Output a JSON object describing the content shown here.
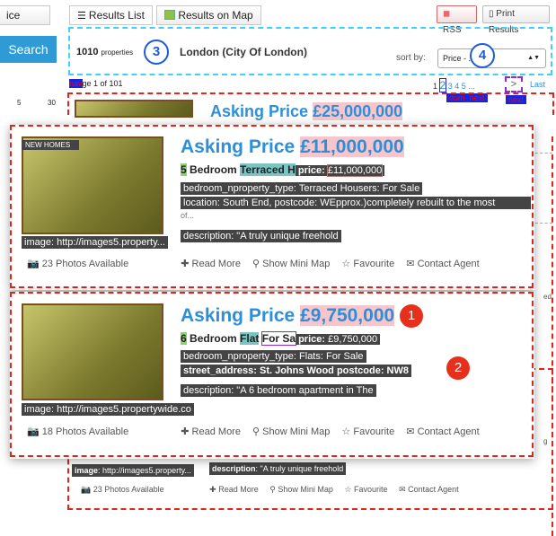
{
  "header": {
    "tab_cut": "ice",
    "tab_results_list": "Results List",
    "tab_results_map": "Results on Map",
    "rss": "RSS",
    "print": "Print Results",
    "search_button": "Search"
  },
  "summary": {
    "count": "1010",
    "count_suffix": "properties",
    "location": "London (City Of London)",
    "sort_label": "sort by:",
    "sort_value": "Price - ...ow"
  },
  "pager": {
    "cut_5": "5",
    "cut_30": "30",
    "nav_tag": "nav",
    "page_text": "ge 1 of 101",
    "pages": [
      "1",
      "2",
      "3",
      "4",
      "5",
      "..."
    ],
    "next_symbol": ">",
    "last": "Last",
    "num_next_tag": "num_next",
    "next_tag": "next"
  },
  "markers": {
    "m1": "1",
    "m2": "2",
    "m3": "3",
    "m4": "4"
  },
  "bg_listing": {
    "price_prefix": "Asking Price",
    "price": "£25,000,000",
    "image_label": "image",
    "image_url": "http://images5.property...",
    "description_label": "description",
    "description": "\"A truly unique freehold",
    "photos": "23 Photos Available",
    "read_more": "Read More",
    "mini_map": "Show Mini Map",
    "favourite": "Favourite",
    "contact": "Contact Agent"
  },
  "listing1": {
    "badge": "NEW HOMES",
    "price_prefix": "Asking Price",
    "price": "£11,000,000",
    "beds": "5",
    "bedroom_word": "Bedroom",
    "type": "Terraced H",
    "price_label": "price",
    "price_value": "£11,000,000",
    "line2": "bedroom_nproperty_type: Terraced Housers: For Sale",
    "line3": "location: South End, postcode: WEpprox.)completely rebuilt to the most",
    "line3b": "of...",
    "line4": "description: \"A truly unique freehold",
    "image_line": "image: http://images5.property...",
    "photos": "23 Photos Available",
    "read_more": "Read More",
    "mini_map": "Show Mini Map",
    "favourite": "Favourite",
    "contact": "Contact Agent"
  },
  "listing2": {
    "price_prefix": "Asking Price",
    "price": "£9,750,000",
    "beds": "6",
    "bedroom_word": "Bedroom",
    "type": "Flat",
    "for_sale": "For Sa",
    "price_label": "price",
    "price_value": "£9,750,000",
    "line2": "bedroom_nproperty_type: Flats: For Sale",
    "line3": "street_address: St. Johns Wood postcode: NW8",
    "line4": "description: \"A 6 bedroom apartment in The",
    "image_line": "image: http://images5.propertywide.co",
    "photos": "18 Photos Available",
    "read_more": "Read More",
    "mini_map": "Show Mini Map",
    "favourite": "Favourite",
    "contact": "Contact Agent"
  },
  "side_cut": {
    "ed": "ed",
    "g": "g"
  },
  "colors": {
    "accent": "#2e8fd8",
    "annotation_red": "#e1251b",
    "annotation_blue": "#1c5bd9",
    "price_highlight": "#f6c6cc"
  }
}
